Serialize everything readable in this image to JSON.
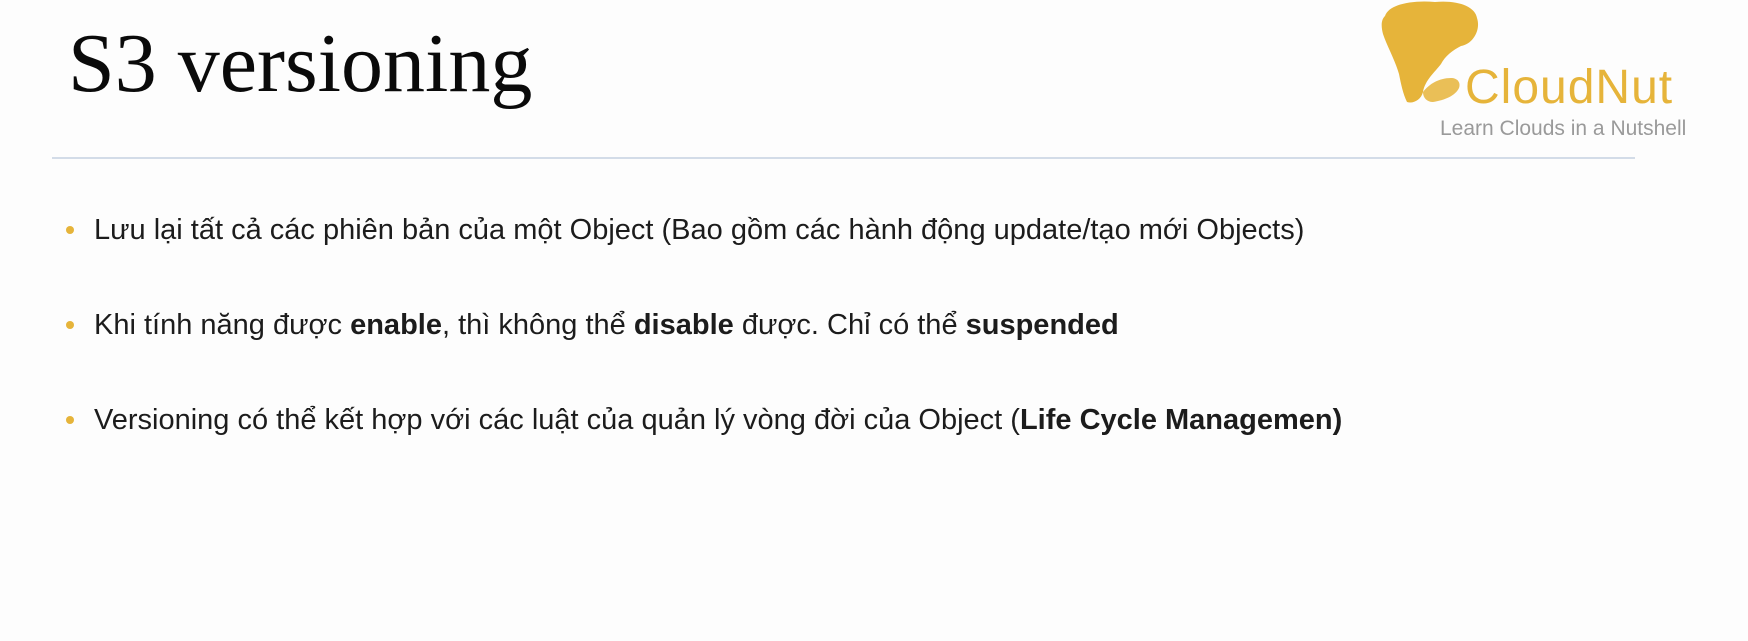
{
  "slide": {
    "title": "S3 versioning",
    "logo": {
      "icon": "cloudnut-head-icon",
      "word_a": "Cloud",
      "word_b": "Nut",
      "tagline": "Learn Clouds in a Nutshell",
      "color": "#e6b43a"
    },
    "bullets": [
      {
        "text": "Lưu lại tất cả các phiên bản của một Object (Bao gồm các hành động update/tạo mới Objects)"
      },
      {
        "t1": "Khi tính năng được ",
        "b1": "enable",
        "t2": ", thì không thể ",
        "b2": "disable",
        "t3": " được. Chỉ có thể ",
        "b3": "suspended"
      },
      {
        "t1": "Versioning có thể kết hợp với các luật của quản lý vòng đời của Object (",
        "b1": "Life Cycle Managemen)"
      }
    ],
    "bullet_color": "#e6b43a",
    "divider_color": "#d3dce8"
  }
}
